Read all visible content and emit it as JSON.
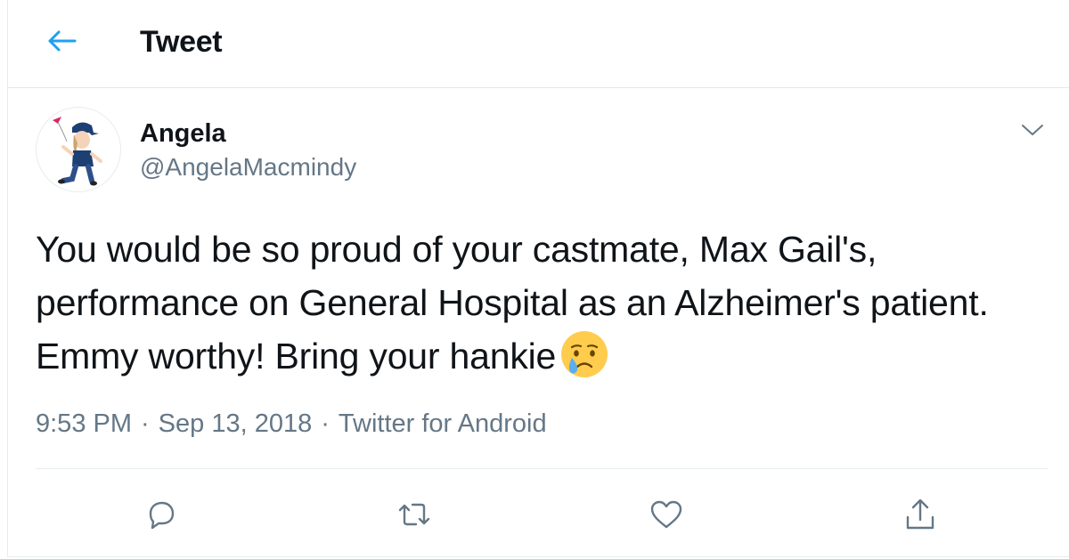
{
  "header": {
    "title": "Tweet",
    "back_icon": "arrow-left-icon",
    "accent_color": "#1da1f2"
  },
  "tweet": {
    "author": {
      "display_name": "Angela",
      "handle": "@AngelaMacmindy",
      "avatar": "cartoon-character-avatar"
    },
    "text": "You would be so proud of your castmate, Max Gail's, performance on General Hospital as an Alzheimer's patient. Emmy worthy! Bring your hankie",
    "emoji": "crying-face-emoji",
    "time": "9:53 PM",
    "separator": "·",
    "date": "Sep 13, 2018",
    "source": "Twitter for Android",
    "menu_icon": "chevron-down-icon"
  },
  "actions": [
    {
      "name": "reply",
      "icon": "reply-icon"
    },
    {
      "name": "retweet",
      "icon": "retweet-icon"
    },
    {
      "name": "like",
      "icon": "heart-icon"
    },
    {
      "name": "share",
      "icon": "share-icon"
    }
  ],
  "colors": {
    "text_primary": "#0f1419",
    "text_secondary": "#657786",
    "divider": "#e6ecf0"
  }
}
